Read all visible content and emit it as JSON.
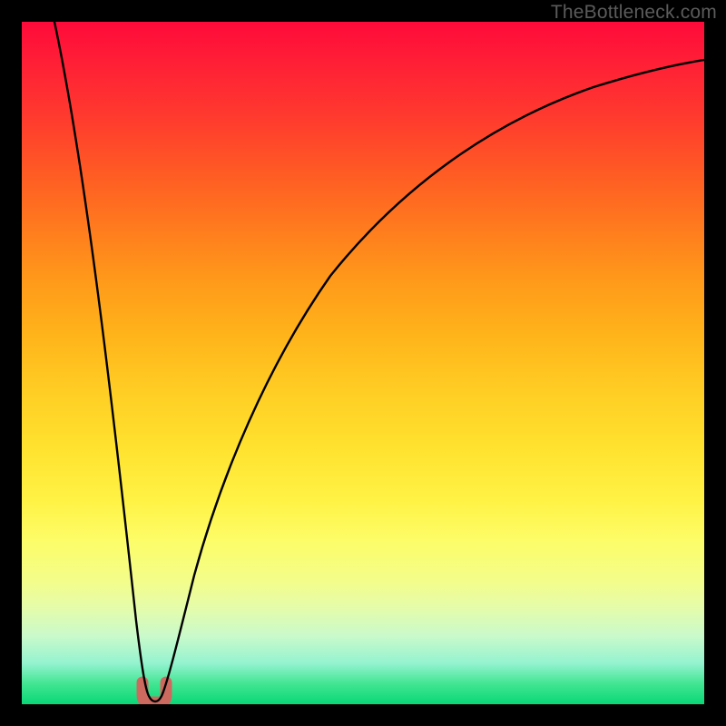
{
  "watermark": "TheBottleneck.com",
  "chart_data": {
    "type": "line",
    "title": "",
    "xlabel": "",
    "ylabel": "",
    "xlim": [
      0,
      100
    ],
    "ylim": [
      0,
      100
    ],
    "grid": false,
    "series": [
      {
        "name": "curve",
        "x_values": [
          0,
          2,
          4,
          6,
          8,
          10,
          12,
          14,
          16,
          17,
          18,
          19,
          20,
          21,
          22,
          24,
          26,
          28,
          30,
          34,
          38,
          42,
          46,
          50,
          56,
          62,
          68,
          74,
          80,
          86,
          92,
          100
        ],
        "y_values": [
          100,
          90,
          80,
          70,
          60,
          50,
          40,
          30,
          16,
          8,
          2,
          1,
          2,
          8,
          16,
          28,
          36,
          43,
          49,
          58,
          64,
          69,
          73,
          76,
          80,
          83,
          85.5,
          87.5,
          89,
          90.5,
          91.5,
          92
        ]
      }
    ],
    "marker": {
      "name": "dip-marker",
      "x": 19,
      "width": 3,
      "color": "#cc6a60"
    },
    "background_gradient": {
      "top": "#ff0a3a",
      "bottom": "#09d877"
    }
  }
}
